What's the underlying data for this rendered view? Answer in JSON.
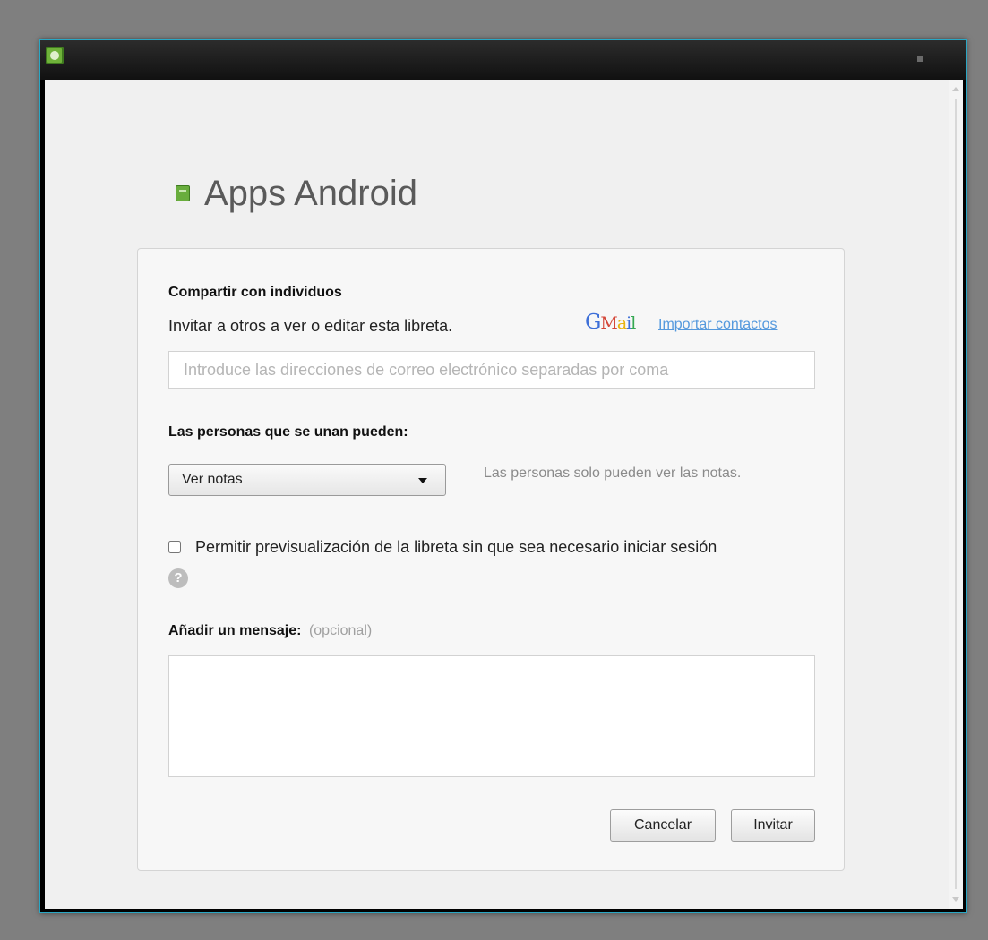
{
  "window": {
    "title": ""
  },
  "page": {
    "title": "Apps Android"
  },
  "share": {
    "heading": "Compartir con individuos",
    "description": "Invitar a otros a ver o editar esta libreta.",
    "gmail_logo": [
      "G",
      "M",
      "a",
      "i",
      "l"
    ],
    "import_link": "Importar contactos",
    "email_placeholder": "Introduce las direcciones de correo electrónico separadas por coma",
    "email_value": ""
  },
  "permissions": {
    "heading": "Las personas que se unan pueden:",
    "selected": "Ver notas",
    "description": "Las personas solo pueden ver las notas."
  },
  "preview": {
    "checked": false,
    "label": "Permitir previsualización de la libreta sin que sea necesario iniciar sesión",
    "help_glyph": "?"
  },
  "message": {
    "heading": "Añadir un mensaje:",
    "optional": "(opcional)",
    "value": ""
  },
  "buttons": {
    "cancel": "Cancelar",
    "invite": "Invitar"
  },
  "icons": {
    "app": "evernote-icon",
    "notebook": "notebook-icon",
    "help": "help-icon",
    "dropdown": "chevron-down-icon"
  },
  "colors": {
    "accent_green": "#69ad3d",
    "link_blue": "#5599dd",
    "window_border": "#2aa7c4"
  }
}
